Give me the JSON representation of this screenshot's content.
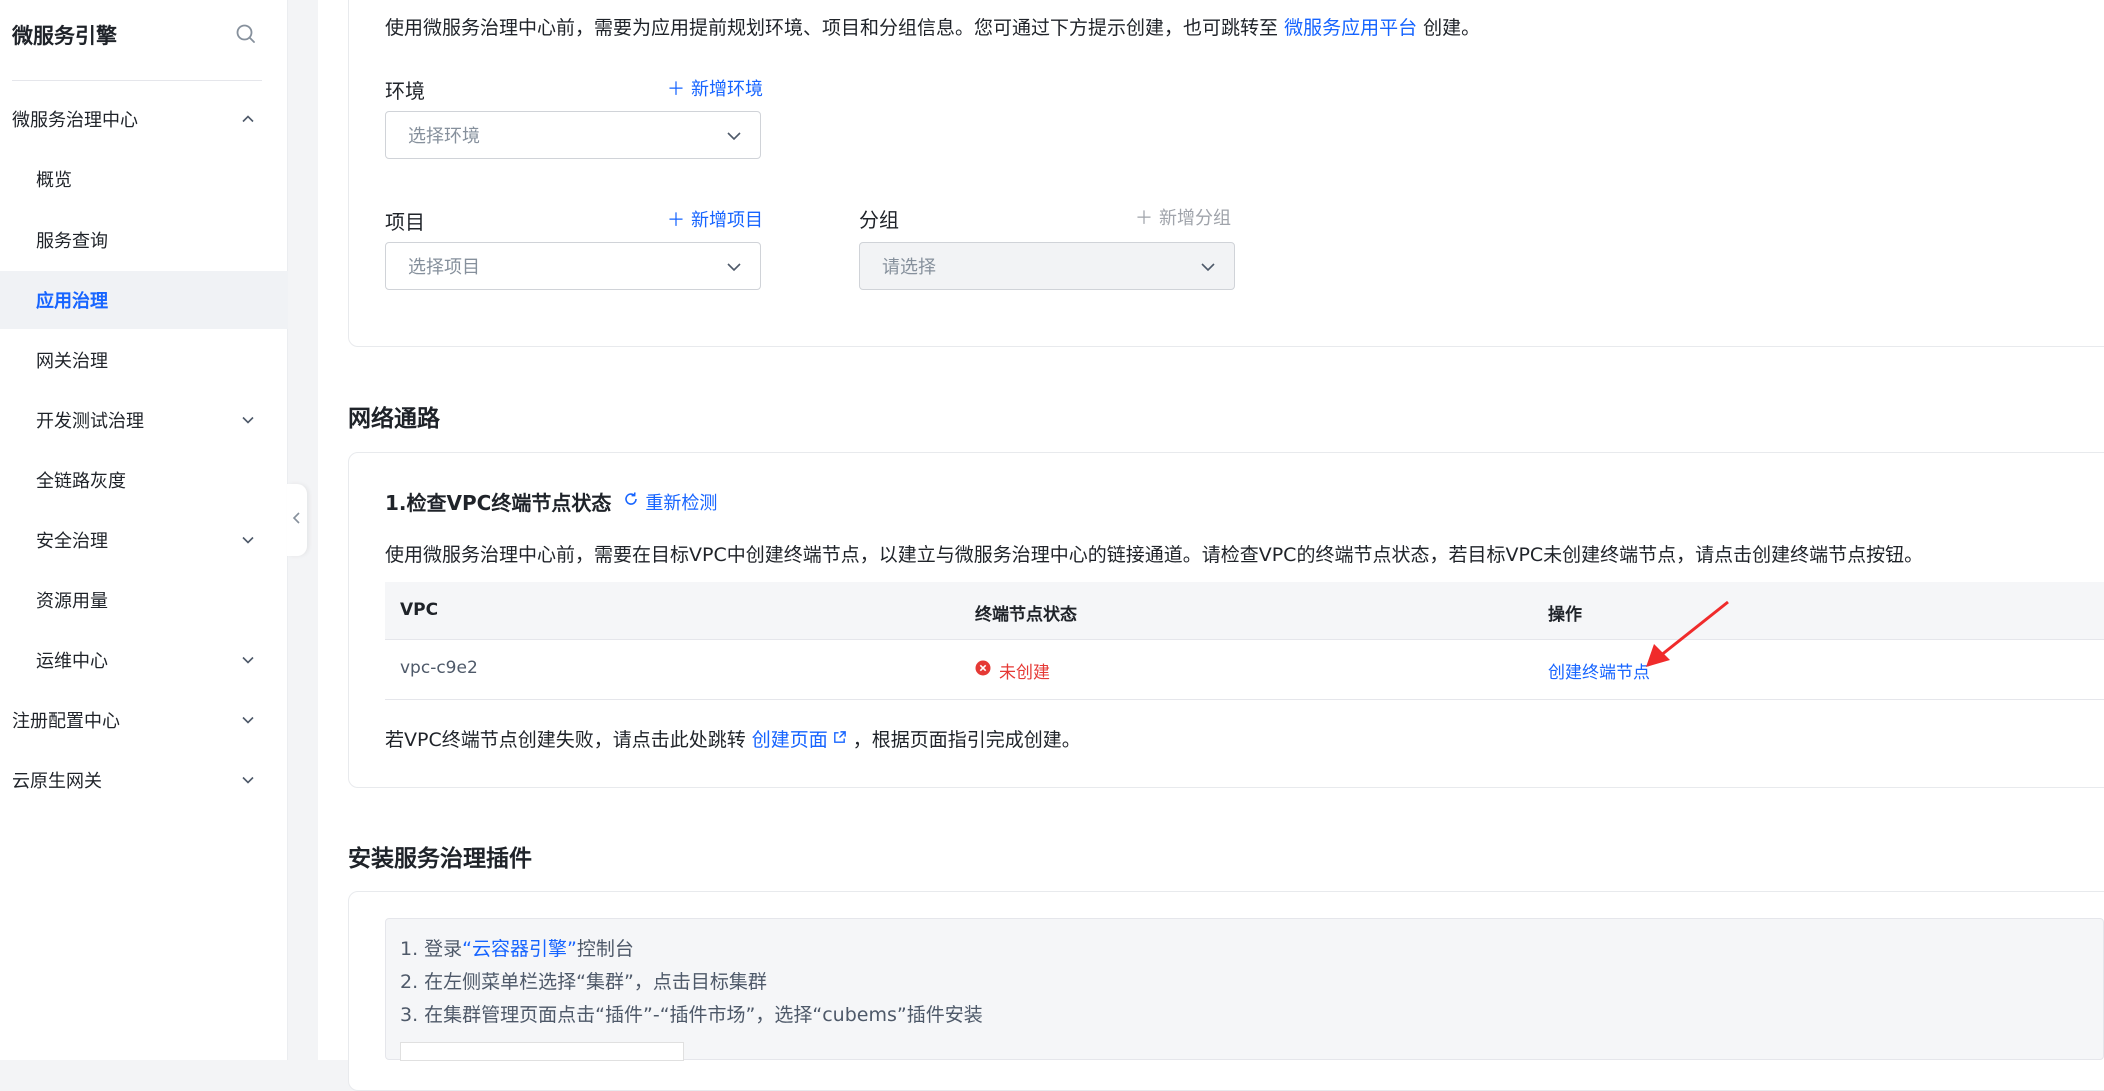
{
  "sidebar": {
    "title": "微服务引擎",
    "items": [
      {
        "label": "微服务治理中心"
      },
      {
        "label": "概览"
      },
      {
        "label": "服务查询"
      },
      {
        "label": "应用治理"
      },
      {
        "label": "网关治理"
      },
      {
        "label": "开发测试治理"
      },
      {
        "label": "全链路灰度"
      },
      {
        "label": "安全治理"
      },
      {
        "label": "资源用量"
      },
      {
        "label": "运维中心"
      },
      {
        "label": "注册配置中心"
      },
      {
        "label": "云原生网关"
      }
    ]
  },
  "config": {
    "intro_prefix": "使用微服务治理中心前，需要为应用提前规划环境、项目和分组信息。您可通过下方提示创建，也可跳转至",
    "intro_link": "微服务应用平台",
    "intro_suffix": "创建。",
    "env_label": "环境",
    "env_add": "新增环境",
    "env_placeholder": "选择环境",
    "project_label": "项目",
    "project_add": "新增项目",
    "project_placeholder": "选择项目",
    "group_label": "分组",
    "group_add": "新增分组",
    "group_placeholder": "请选择"
  },
  "network": {
    "section_title": "网络通路",
    "step_title": "1.检查VPC终端节点状态",
    "recheck": "重新检测",
    "desc": "使用微服务治理中心前，需要在目标VPC中创建终端节点，以建立与微服务治理中心的链接通道。请检查VPC的终端节点状态，若目标VPC未创建终端节点，请点击创建终端节点按钮。",
    "columns": [
      "VPC",
      "终端节点状态",
      "操作"
    ],
    "rows": [
      {
        "vpc": "vpc-c9e2",
        "status": "未创建",
        "action": "创建终端节点"
      }
    ],
    "fail_prefix": "若VPC终端节点创建失败，请点击此处跳转",
    "fail_link": "创建页面",
    "fail_suffix": "，根据页面指引完成创建。"
  },
  "install": {
    "section_title": "安装服务治理插件",
    "step1_prefix": "1. 登录",
    "step1_link": "“云容器引擎”",
    "step1_suffix": "控制台",
    "step2": "2. 在左侧菜单栏选择“集群”，点击目标集群",
    "step3": "3. 在集群管理页面点击“插件”-“插件市场”，选择“cubems”插件安装"
  },
  "colors": {
    "accent": "#1664ff",
    "error": "#e53935",
    "annotation_arrow": "#f02b2b"
  }
}
